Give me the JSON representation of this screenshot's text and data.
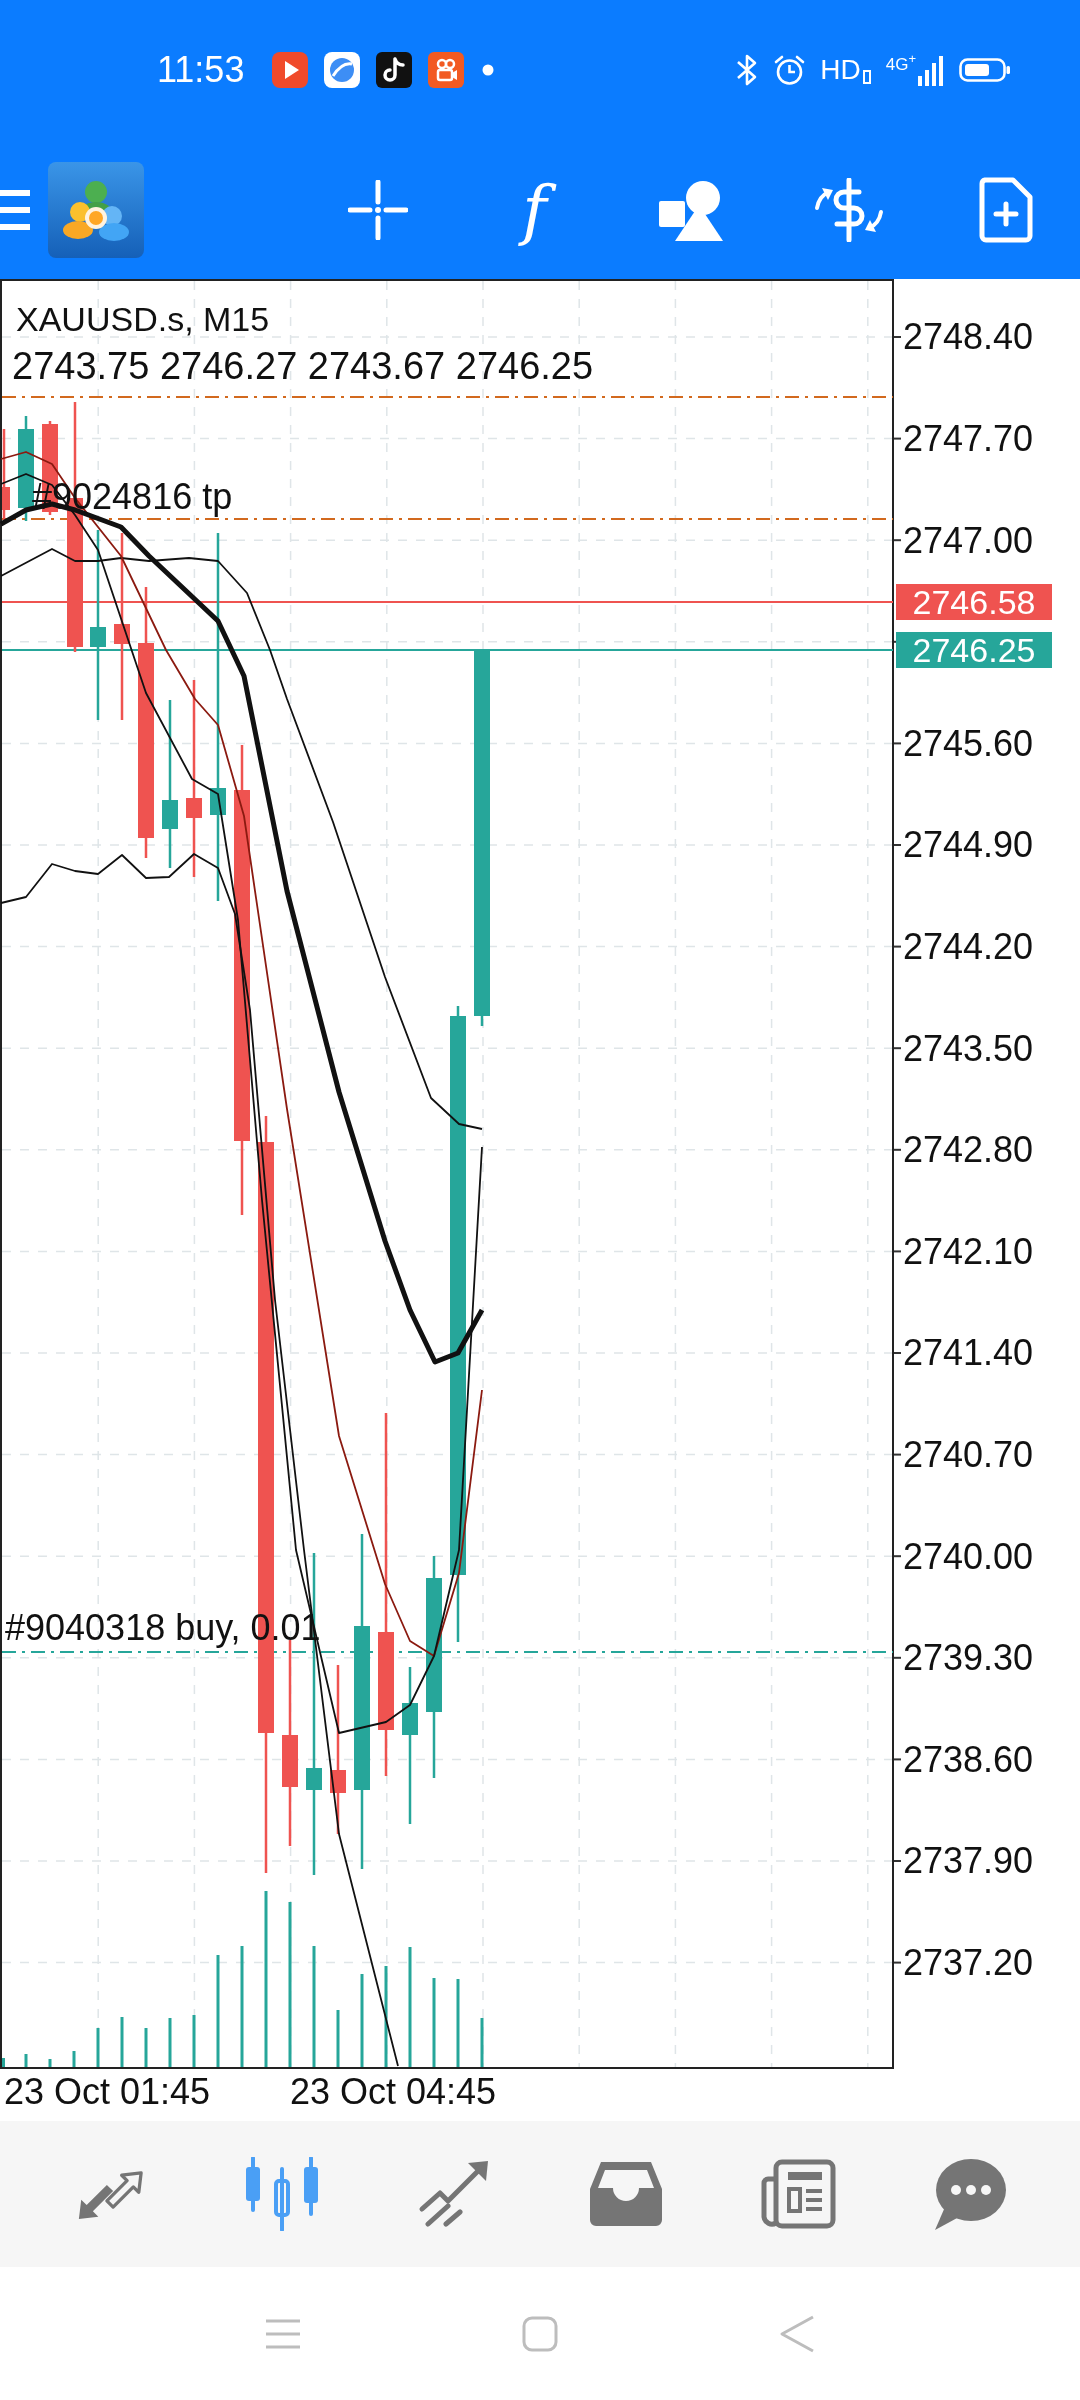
{
  "status_bar": {
    "time": "11:53",
    "hd_label": "HD",
    "network_label": "4G$^{+}$"
  },
  "toolbar": {
    "function_button": "f"
  },
  "chart": {
    "symbol": "XAUUSD.s, M15",
    "ohlc": "2743.75 2746.27 2743.67 2746.25",
    "order_labels": [
      {
        "kind": "take_profit",
        "text": "#9024816 tp"
      },
      {
        "kind": "buy",
        "text": "#9040318 buy, 0.01"
      }
    ],
    "price_tags": [
      {
        "kind": "ask",
        "text": "2746.58"
      },
      {
        "kind": "bid",
        "text": "2746.25"
      }
    ],
    "price_axis": [
      "2748.40",
      "2747.70",
      "2747.00",
      "2745.60",
      "2744.90",
      "2744.20",
      "2743.50",
      "2742.80",
      "2742.10",
      "2741.40",
      "2740.70",
      "2740.00",
      "2739.30",
      "2738.60",
      "2737.90",
      "2737.20"
    ],
    "time_axis": [
      "23 Oct 01:45",
      "23 Oct 04:45"
    ]
  },
  "bottom_nav": [
    {
      "kind": "arrows",
      "selected": false
    },
    {
      "kind": "candles",
      "selected": true
    },
    {
      "kind": "trend",
      "selected": false
    },
    {
      "kind": "tray",
      "selected": false
    },
    {
      "kind": "news",
      "selected": false
    },
    {
      "kind": "chat",
      "selected": false
    }
  ]
}
